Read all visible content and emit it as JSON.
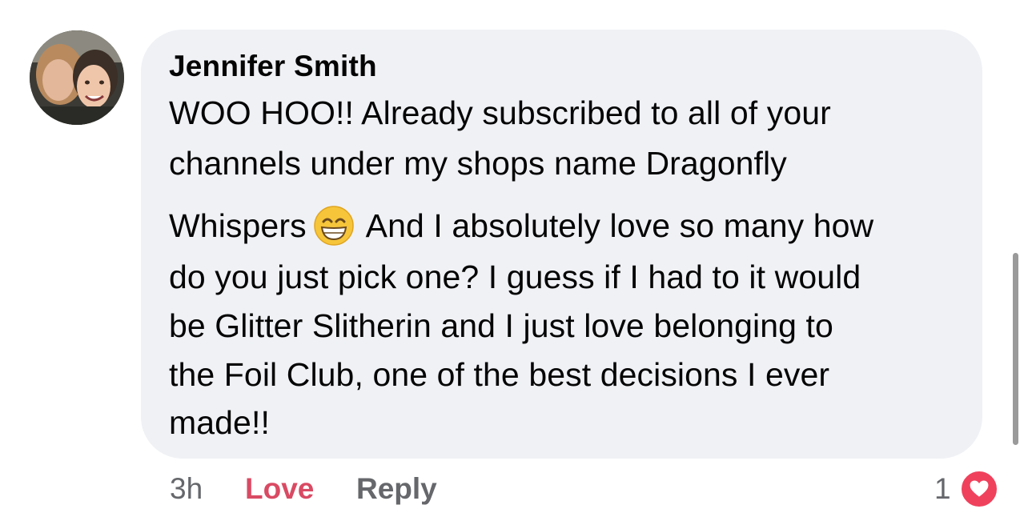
{
  "comment": {
    "author": "Jennifer Smith",
    "lines": [
      "WOO HOO!! Already subscribed to all of your",
      "channels under my shops name Dragonfly",
      "Whispers",
      "And I absolutely love so many how",
      "do you just pick one? I guess if I had to it would",
      "be Glitter Slitherin and I just love belonging to",
      "the Foil Club, one of the best decisions I ever",
      "made!!"
    ],
    "emoji": "grinning-face-with-smiling-eyes-icon"
  },
  "actions": {
    "time": "3h",
    "love_label": "Love",
    "reply_label": "Reply"
  },
  "reactions": {
    "count": "1",
    "type": "heart-icon",
    "color": "#f0415c"
  },
  "colors": {
    "bubble": "#f0f1f5",
    "love_active": "#d94a63",
    "muted": "#65676b"
  }
}
